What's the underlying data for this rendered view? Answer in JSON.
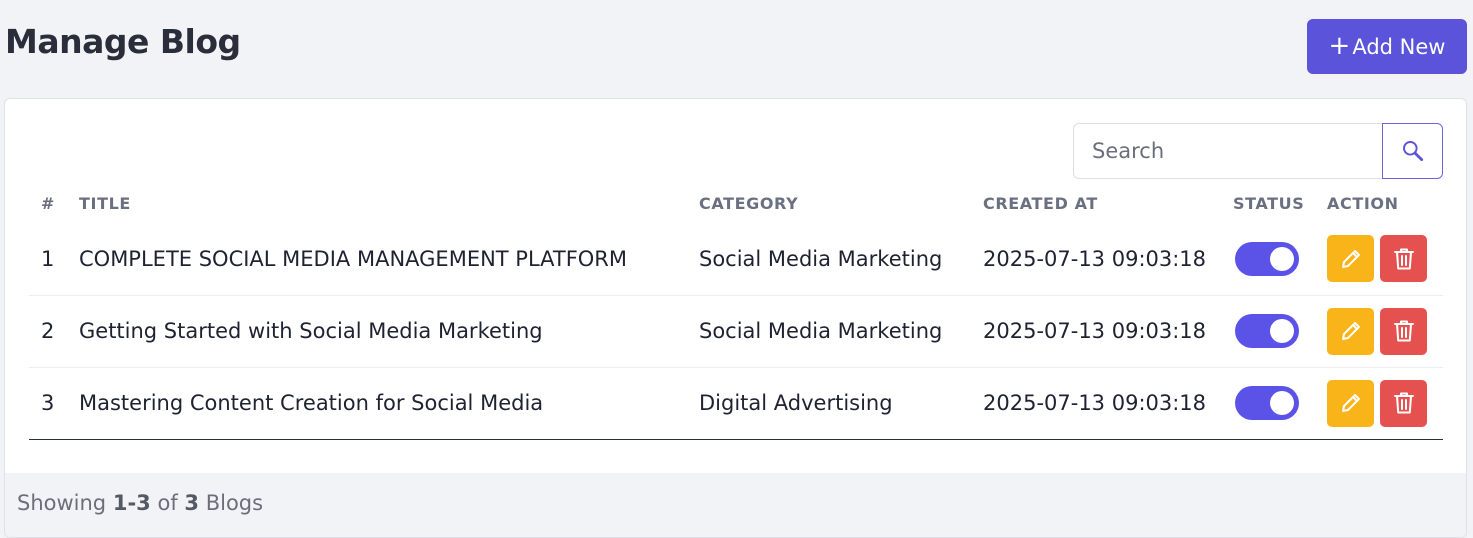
{
  "header": {
    "title": "Manage Blog",
    "add_button": {
      "icon": "plus-icon",
      "label": "Add New"
    }
  },
  "search": {
    "placeholder": "Search",
    "value": "",
    "icon": "search-icon"
  },
  "table": {
    "columns": [
      "#",
      "TITLE",
      "CATEGORY",
      "CREATED AT",
      "STATUS",
      "ACTION"
    ],
    "rows": [
      {
        "num": "1",
        "title": "COMPLETE SOCIAL MEDIA MANAGEMENT PLATFORM",
        "category": "Social Media Marketing",
        "created_at": "2025-07-13 09:03:18",
        "status_on": true
      },
      {
        "num": "2",
        "title": "Getting Started with Social Media Marketing",
        "category": "Social Media Marketing",
        "created_at": "2025-07-13 09:03:18",
        "status_on": true
      },
      {
        "num": "3",
        "title": "Mastering Content Creation for Social Media",
        "category": "Digital Advertising",
        "created_at": "2025-07-13 09:03:18",
        "status_on": true
      }
    ],
    "action_icons": {
      "edit": "pencil-icon",
      "delete": "trash-icon"
    }
  },
  "footer": {
    "prefix": "Showing",
    "range": "1-3",
    "of": "of",
    "total": "3",
    "suffix": "Blogs"
  },
  "colors": {
    "primary": "#5b53d9",
    "toggle_on": "#5b53e8",
    "edit": "#f8b418",
    "delete": "#e5514f",
    "background": "#f2f3f7"
  }
}
